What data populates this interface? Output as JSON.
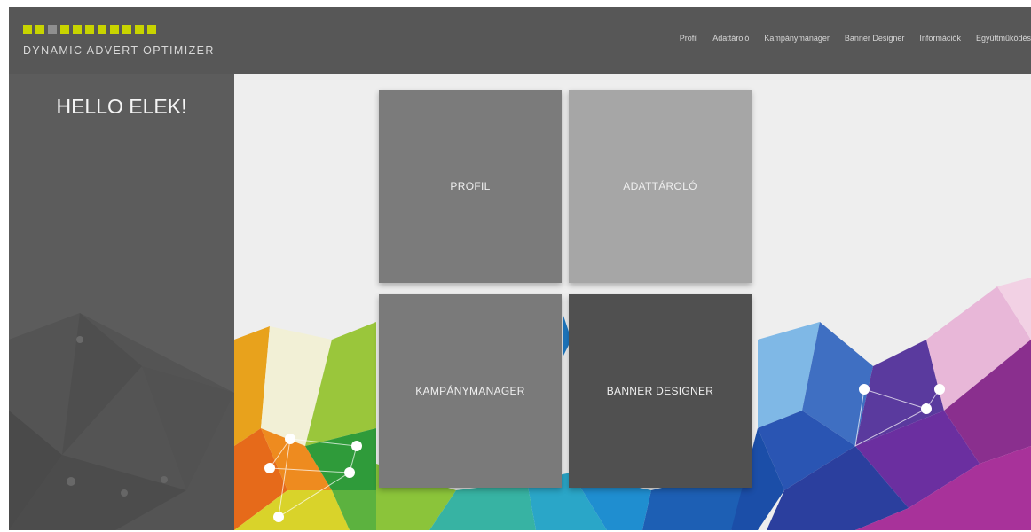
{
  "header": {
    "logo_text": "DYNAMIC ADVERT OPTIMIZER",
    "logo_squares": [
      "#c8d400",
      "#c8d400",
      "#8f8f8f",
      "#c8d400",
      "#c8d400",
      "#c8d400",
      "#c8d400",
      "#c8d400",
      "#c8d400",
      "#c8d400",
      "#c8d400"
    ],
    "nav": [
      "Profil",
      "Adattároló",
      "Kampánymanager",
      "Banner Designer",
      "Információk",
      "Együttműködés"
    ]
  },
  "sidebar": {
    "greeting": "HELLO ELEK!"
  },
  "tiles": [
    {
      "label": "PROFIL"
    },
    {
      "label": "ADATTÁROLÓ"
    },
    {
      "label": "KAMPÁNYMANAGER"
    },
    {
      "label": "BANNER DESIGNER"
    }
  ],
  "colors": {
    "header_bg": "#575757",
    "sidebar_bg": "#5c5c5c",
    "accent": "#c8d400",
    "main_bg": "#eeeeee"
  }
}
